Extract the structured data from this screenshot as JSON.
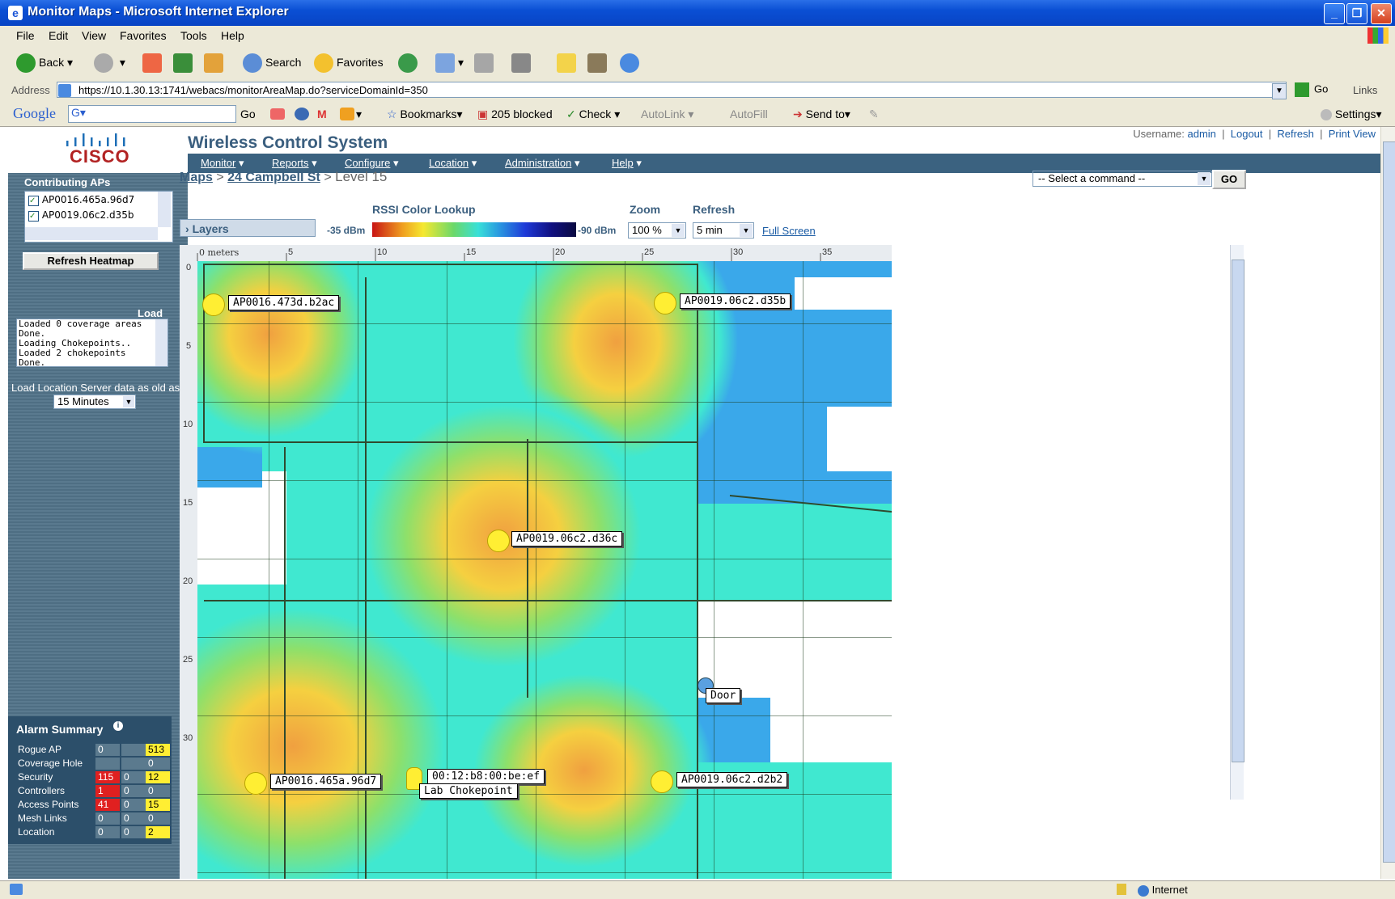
{
  "window": {
    "title": "Monitor Maps - Microsoft Internet Explorer"
  },
  "menubar": [
    "File",
    "Edit",
    "View",
    "Favorites",
    "Tools",
    "Help"
  ],
  "toolbar": {
    "back": "Back",
    "search": "Search",
    "favorites": "Favorites"
  },
  "address": {
    "label": "Address",
    "url": "https://10.1.30.13:1741/webacs/monitorAreaMap.do?serviceDomainId=350",
    "go": "Go",
    "links": "Links"
  },
  "googlebar": {
    "brand": "Google",
    "go": "Go",
    "bookmarks": "Bookmarks",
    "blocked": "205 blocked",
    "check": "Check",
    "autolink": "AutoLink",
    "autofill": "AutoFill",
    "sendto": "Send to",
    "settings": "Settings"
  },
  "header": {
    "brand": "CISCO",
    "app_title": "Wireless Control System",
    "username_label": "Username:",
    "username": "admin",
    "logout": "Logout",
    "refresh": "Refresh",
    "print_view": "Print View"
  },
  "nav": [
    "Monitor",
    "Reports",
    "Configure",
    "Location",
    "Administration",
    "Help"
  ],
  "breadcrumb": {
    "maps": "Maps",
    "building": "24 Campbell St",
    "sep": ">",
    "floor": "Level 15"
  },
  "command": {
    "select": "-- Select a command --",
    "go": "GO"
  },
  "sidebar": {
    "contributing_title": "Contributing APs",
    "aps": [
      "AP0016.465a.96d7",
      "AP0019.06c2.d35b"
    ],
    "refresh_heatmap": "Refresh Heatmap",
    "load_label": "Load",
    "log": [
      "Loaded 0 coverage areas",
      "Done.",
      "Loading Chokepoints..",
      "Loaded 2 chokepoints",
      "Done."
    ],
    "location_server_label": "Load Location Server data as old as:",
    "location_server_value": "15 Minutes"
  },
  "alarm_summary": {
    "title": "Alarm Summary",
    "rows": [
      {
        "name": "Rogue AP",
        "critical": "0",
        "major": "",
        "minor": "513"
      },
      {
        "name": "Coverage Hole",
        "critical": "",
        "major": "",
        "minor": "0"
      },
      {
        "name": "Security",
        "critical": "115",
        "major": "0",
        "minor": "12"
      },
      {
        "name": "Controllers",
        "critical": "1",
        "major": "0",
        "minor": "0"
      },
      {
        "name": "Access Points",
        "critical": "41",
        "major": "0",
        "minor": "15"
      },
      {
        "name": "Mesh Links",
        "critical": "0",
        "major": "0",
        "minor": "0"
      },
      {
        "name": "Location",
        "critical": "0",
        "major": "0",
        "minor": "2"
      }
    ],
    "colors": {
      "critical": "#e02020",
      "minor": "#ffee33",
      "neutral": "#5b7a8e"
    }
  },
  "controls": {
    "layers": "Layers",
    "rssi_title": "RSSI Color Lookup",
    "rssi_min": "-35 dBm",
    "rssi_max": "-90 dBm",
    "zoom_title": "Zoom",
    "zoom_value": "100 %",
    "refresh_title": "Refresh",
    "refresh_value": "5 min",
    "full_screen": "Full Screen"
  },
  "map": {
    "ruler_x": [
      "0 meters",
      "5",
      "10",
      "15",
      "20",
      "25",
      "30",
      "35"
    ],
    "ruler_y": [
      "0",
      "5",
      "10",
      "15",
      "20",
      "25",
      "30"
    ],
    "aps": [
      {
        "name": "AP0016.473d.b2ac"
      },
      {
        "name": "AP0019.06c2.d35b"
      },
      {
        "name": "AP0019.06c2.d36c"
      },
      {
        "name": "AP0016.465a.96d7"
      },
      {
        "name": "AP0019.06c2.d2b2"
      }
    ],
    "chokepoint": {
      "mac": "00:12:b8:00:be:ef",
      "name": "Lab Chokepoint"
    },
    "door": "Door"
  },
  "status": {
    "zone": "Internet"
  }
}
